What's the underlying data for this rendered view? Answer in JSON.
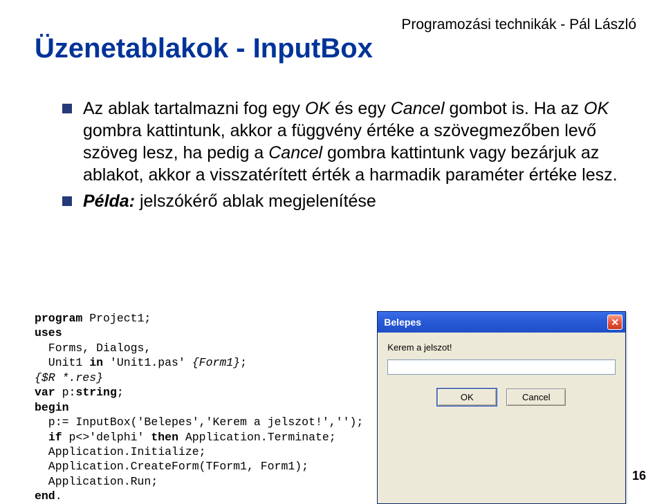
{
  "header": {
    "credit": "Programozási technikák - Pál László"
  },
  "title": "Üzenetablakok - InputBox",
  "bullets": [
    {
      "text_html": "Az ablak tartalmazni fog egy <i>OK</i> és egy <i>Cancel</i> gombot is. Ha az <i>OK</i> gombra kattintunk, akkor a függvény értéke a szövegmezőben levő szöveg lesz, ha pedig a <i>Cancel</i> gombra kattintunk vagy bezárjuk az ablakot, akkor a visszatérített érték a harmadik paraméter értéke lesz."
    },
    {
      "text_html": "<b><i>Példa:</i></b> jelszókérő ablak megjelenítése"
    }
  ],
  "code_html": "<span class=\"kw\">program</span> Project1;\n<span class=\"kw\">uses</span>\n  Forms, Dialogs,\n  Unit1 <span class=\"kw\">in</span> 'Unit1.pas' <i>{Form1}</i>;\n<i>{$R *.res}</i>\n<span class=\"kw\">var</span> p:<span class=\"kw\">string</span>;\n<span class=\"kw\">begin</span>\n  p:= InputBox('Belepes','Kerem a jelszot!','');\n  <span class=\"kw\">if</span> p<>'delphi' <span class=\"kw\">then</span> Application.Terminate;\n  Application.Initialize;\n  Application.CreateForm(TForm1, Form1);\n  Application.Run;\n<span class=\"kw\">end</span>.",
  "dialog": {
    "title": "Belepes",
    "close_glyph": "✕",
    "prompt": "Kerem a jelszot!",
    "input_value": "",
    "ok_label": "OK",
    "cancel_label": "Cancel"
  },
  "page_number": "16"
}
